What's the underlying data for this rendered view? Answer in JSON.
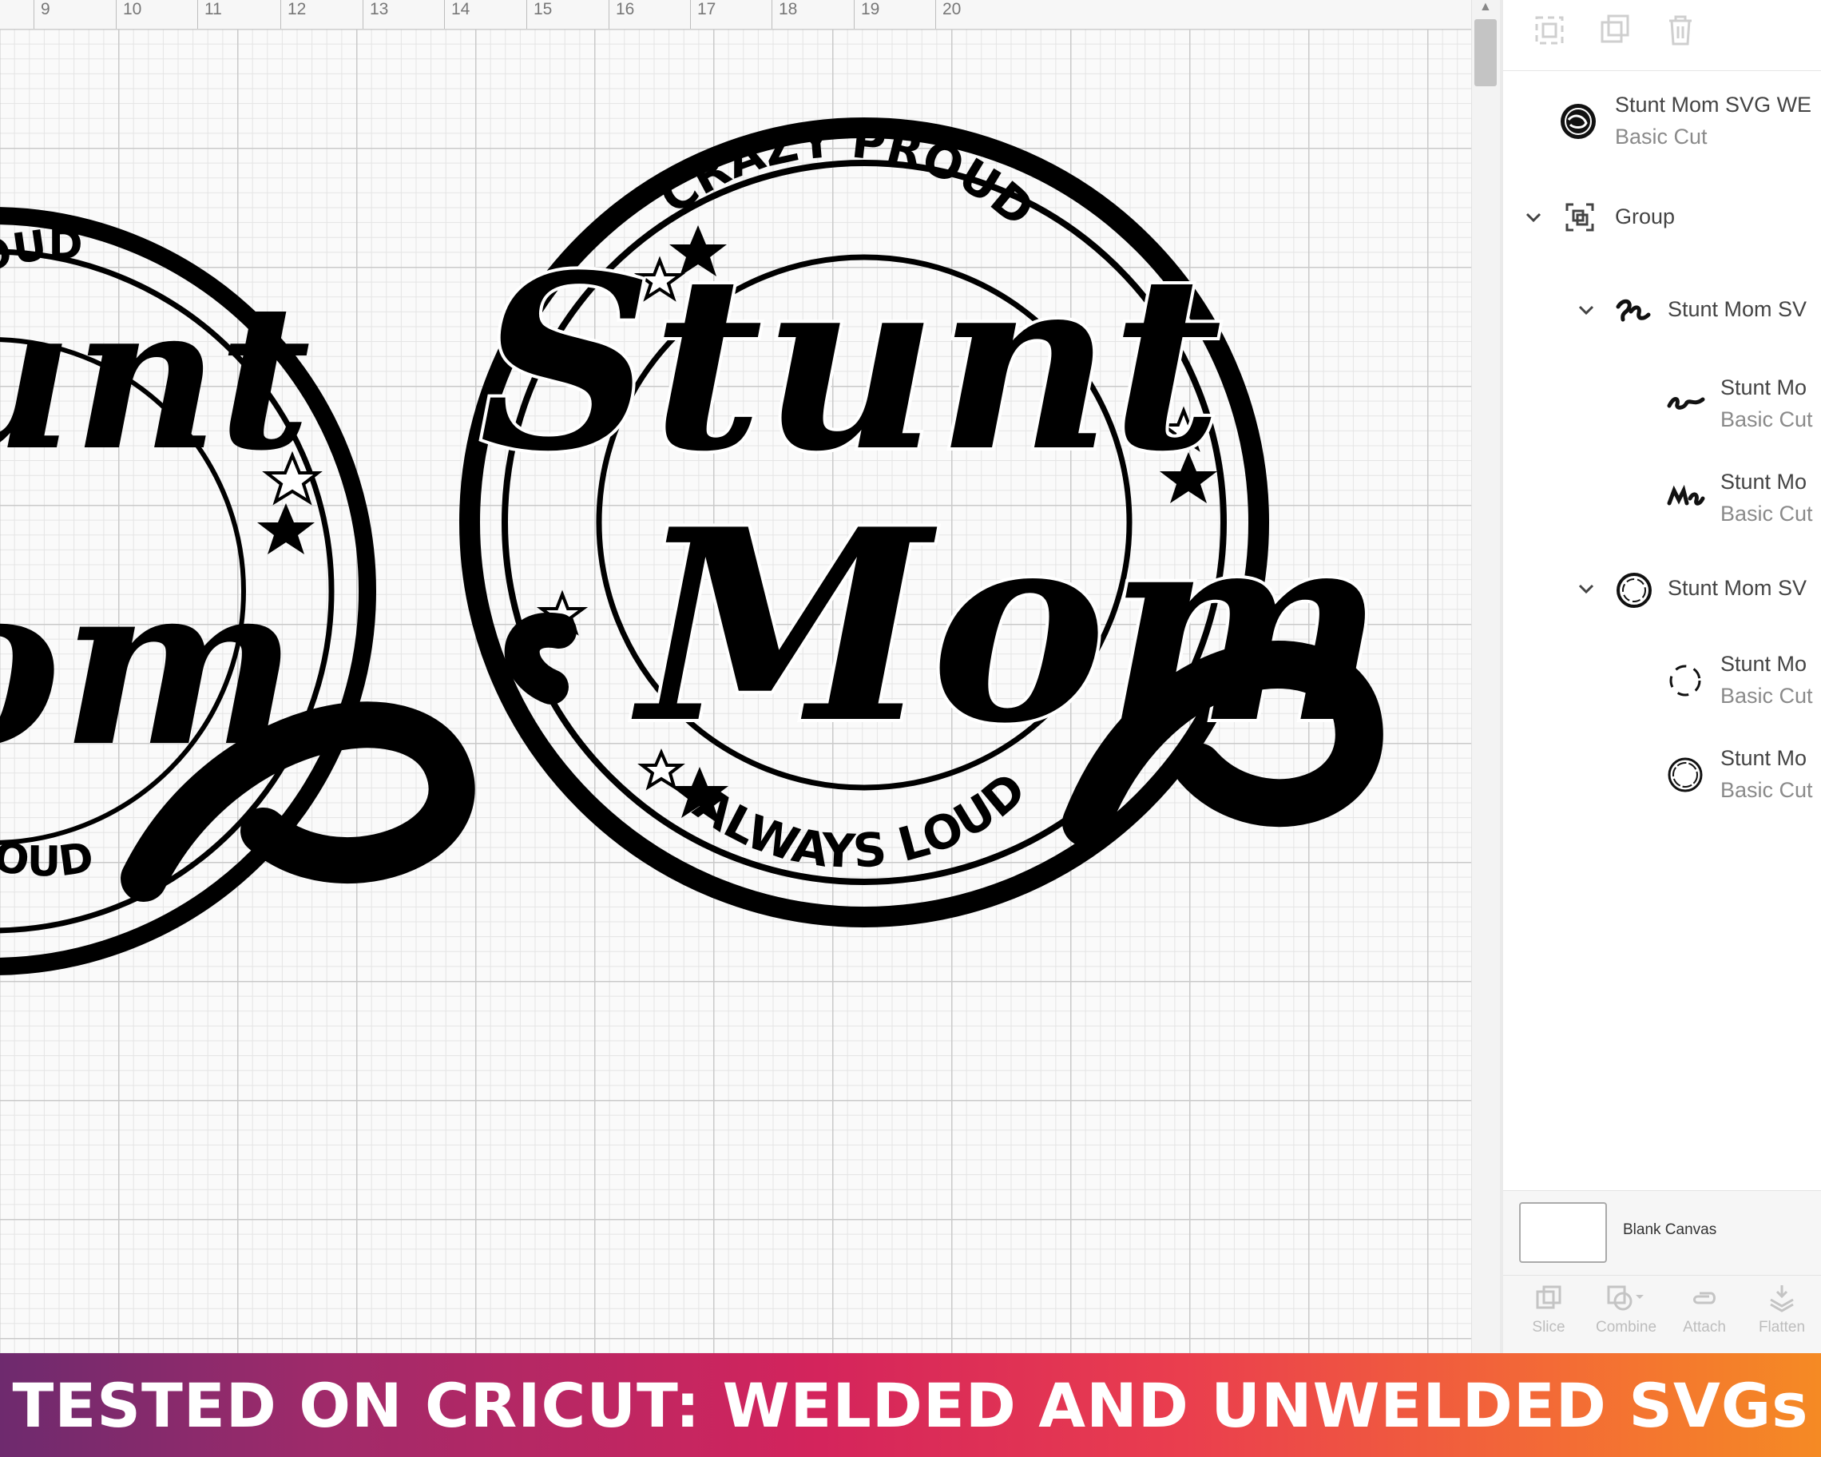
{
  "ruler": {
    "ticks": [
      "9",
      "10",
      "11",
      "12",
      "13",
      "14",
      "15",
      "16",
      "17",
      "18",
      "19",
      "20"
    ]
  },
  "design": {
    "top_arc_text": "CRAZY PROUD",
    "bottom_arc_text": "ALWAYS LOUD",
    "script_line_1": "Stunt",
    "script_line_2": "Mom",
    "partial_top_text": "ROUD",
    "partial_bottom_text": "LOUD",
    "partial_script_1": "unt",
    "partial_script_2": "om"
  },
  "top_toolbar": {
    "icons": [
      "group-icon",
      "duplicate-icon",
      "delete-icon"
    ]
  },
  "layers": [
    {
      "name": "Stunt Mom SVG WE",
      "sub": "Basic Cut",
      "thumb": "round-logo-thumb",
      "level": 0,
      "expanded": null
    },
    {
      "name": "Group",
      "sub": "",
      "thumb": "group-icon",
      "level": 0,
      "expanded": true
    },
    {
      "name": "Stunt Mom SV",
      "sub": "",
      "thumb": "script-thumb",
      "level": 1,
      "expanded": true
    },
    {
      "name": "Stunt Mo",
      "sub": "Basic Cut",
      "thumb": "stunt-word-thumb",
      "level": 2,
      "expanded": null
    },
    {
      "name": "Stunt Mo",
      "sub": "Basic Cut",
      "thumb": "mom-word-thumb",
      "level": 2,
      "expanded": null
    },
    {
      "name": "Stunt Mom SV",
      "sub": "",
      "thumb": "ring-thumb",
      "level": 1,
      "expanded": true
    },
    {
      "name": "Stunt Mo",
      "sub": "Basic Cut",
      "thumb": "arc-thumb",
      "level": 2,
      "expanded": null
    },
    {
      "name": "Stunt Mo",
      "sub": "Basic Cut",
      "thumb": "circle-thumb",
      "level": 2,
      "expanded": null
    }
  ],
  "blank_canvas": {
    "label": "Blank Canvas"
  },
  "bottom_toolbar": {
    "slice": "Slice",
    "combine": "Combine",
    "attach": "Attach",
    "flatten": "Flatten"
  },
  "banner": {
    "text": "TESTED ON CRICUT: WELDED AND UNWELDED SVGs"
  },
  "colors": {
    "banner_start": "#6e2a6e",
    "banner_mid": "#d4245c",
    "banner_end": "#f58a24",
    "ink": "#000000"
  }
}
